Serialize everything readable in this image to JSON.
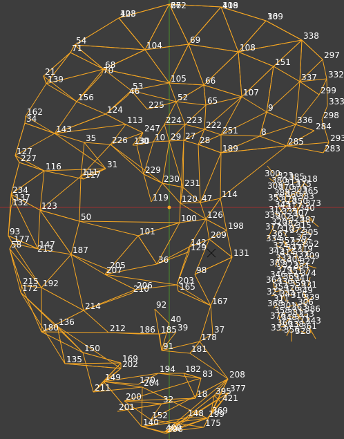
{
  "viewport": {
    "background": "#3d3d3d",
    "wire_color": "#f5a623",
    "x_axis_color": "#a03030",
    "y_axis_color": "#4a8f2a",
    "label_color": "#ffffff"
  },
  "vertex_labels": [
    "67",
    "109",
    "103",
    "10",
    "54",
    "71",
    "104",
    "69",
    "108",
    "338",
    "297",
    "68",
    "70",
    "151",
    "21",
    "139",
    "105",
    "66",
    "53",
    "46",
    "337",
    "332",
    "299",
    "156",
    "52",
    "65",
    "107",
    "333",
    "124",
    "225",
    "9",
    "298",
    "162",
    "34",
    "113",
    "224",
    "223",
    "222",
    "251",
    "336",
    "284",
    "143",
    "247",
    "8",
    "293",
    "35",
    "226",
    "130",
    "30",
    "10",
    "29",
    "27",
    "28",
    "189",
    "285",
    "283",
    "127",
    "227",
    "31",
    "111",
    "117",
    "116",
    "229",
    "230",
    "231",
    "120",
    "47",
    "119",
    "114",
    "126",
    "123",
    "50",
    "100",
    "101",
    "198",
    "209",
    "234",
    "137",
    "132",
    "93",
    "177",
    "58",
    "147",
    "213",
    "187",
    "205",
    "207",
    "36",
    "142",
    "129",
    "131",
    "98",
    "203",
    "165",
    "206",
    "210",
    "215",
    "192",
    "172",
    "214",
    "92",
    "40",
    "167",
    "37",
    "212",
    "186",
    "185",
    "39",
    "91",
    "178",
    "181",
    "180",
    "136",
    "135",
    "150",
    "169",
    "202",
    "211",
    "149",
    "170",
    "204",
    "194",
    "182",
    "83",
    "18",
    "200",
    "32",
    "201",
    "140",
    "148",
    "199",
    "400",
    "175",
    "396",
    "152",
    "208",
    "377",
    "395",
    "421",
    "369",
    "262",
    "418",
    "428",
    "369"
  ]
}
